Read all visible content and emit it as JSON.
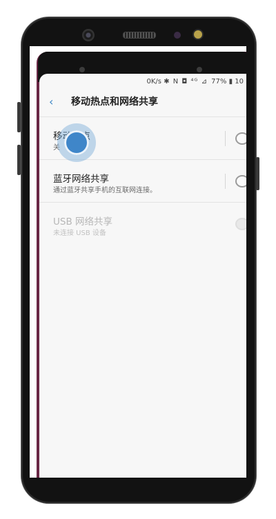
{
  "status_bar": {
    "speed": "0K/s",
    "icons": "✱ N ◘ ⁴ᴳ ⊿",
    "battery": "77%",
    "time_partial": "10"
  },
  "header": {
    "back_label": "‹",
    "title": "移动热点和网络共享"
  },
  "settings": [
    {
      "title": "移动热点",
      "subtitle": "关",
      "enabled": true,
      "toggle_on": false
    },
    {
      "title": "蓝牙网络共享",
      "subtitle": "通过蓝牙共享手机的互联网连接。",
      "enabled": true,
      "toggle_on": false
    },
    {
      "title": "USB 网络共享",
      "subtitle": "未连接 USB 设备",
      "enabled": false,
      "toggle_on": false
    }
  ],
  "colors": {
    "accent": "#3b86c6",
    "touch_indicator": "#3f86c9",
    "phone_body": "#121212"
  }
}
